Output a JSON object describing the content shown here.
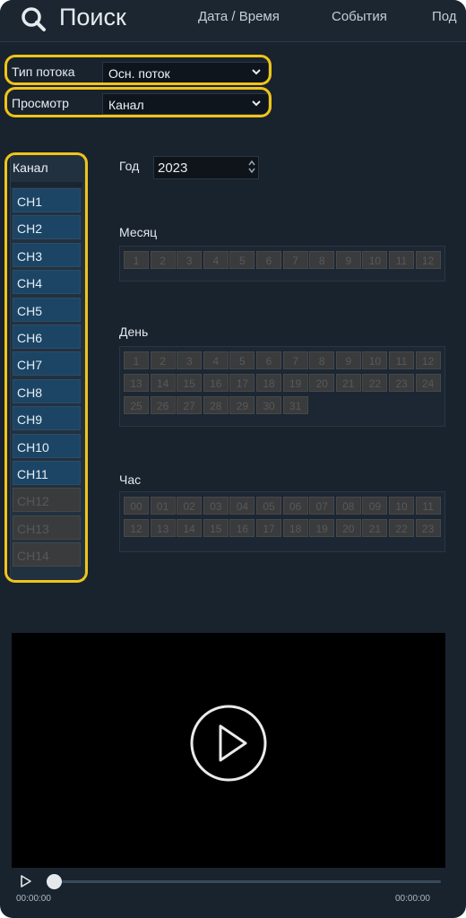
{
  "header": {
    "title": "Поиск",
    "nav": [
      "Дата / Время",
      "События",
      "Под"
    ]
  },
  "filters": {
    "stream_type": {
      "label": "Тип потока",
      "value": "Осн. поток"
    },
    "view": {
      "label": "Просмотр",
      "value": "Канал"
    }
  },
  "channels": {
    "title": "Канал",
    "items": [
      {
        "label": "CH1",
        "enabled": true
      },
      {
        "label": "CH2",
        "enabled": true
      },
      {
        "label": "CH3",
        "enabled": true
      },
      {
        "label": "CH4",
        "enabled": true
      },
      {
        "label": "CH5",
        "enabled": true
      },
      {
        "label": "CH6",
        "enabled": true
      },
      {
        "label": "CH7",
        "enabled": true
      },
      {
        "label": "CH8",
        "enabled": true
      },
      {
        "label": "CH9",
        "enabled": true
      },
      {
        "label": "CH10",
        "enabled": true
      },
      {
        "label": "CH11",
        "enabled": true
      },
      {
        "label": "CH12",
        "enabled": false
      },
      {
        "label": "CH13",
        "enabled": false
      },
      {
        "label": "CH14",
        "enabled": false
      }
    ]
  },
  "year": {
    "label": "Год",
    "value": "2023"
  },
  "month": {
    "label": "Месяц",
    "cells": [
      "1",
      "2",
      "3",
      "4",
      "5",
      "6",
      "7",
      "8",
      "9",
      "10",
      "11",
      "12"
    ]
  },
  "day": {
    "label": "День",
    "cells": [
      "1",
      "2",
      "3",
      "4",
      "5",
      "6",
      "7",
      "8",
      "9",
      "10",
      "11",
      "12",
      "13",
      "14",
      "15",
      "16",
      "17",
      "18",
      "19",
      "20",
      "21",
      "22",
      "23",
      "24",
      "25",
      "26",
      "27",
      "28",
      "29",
      "30",
      "31"
    ]
  },
  "hour": {
    "label": "Час",
    "cells": [
      "00",
      "01",
      "02",
      "03",
      "04",
      "05",
      "06",
      "07",
      "08",
      "09",
      "10",
      "11",
      "12",
      "13",
      "14",
      "15",
      "16",
      "17",
      "18",
      "19",
      "20",
      "21",
      "22",
      "23"
    ]
  },
  "player": {
    "time_start": "00:00:00",
    "time_end": "00:00:00",
    "progress": 0
  },
  "colors": {
    "highlight": "#f0c419",
    "channel_active": "#1c4565",
    "cell_disabled": "#3a3b3c"
  }
}
